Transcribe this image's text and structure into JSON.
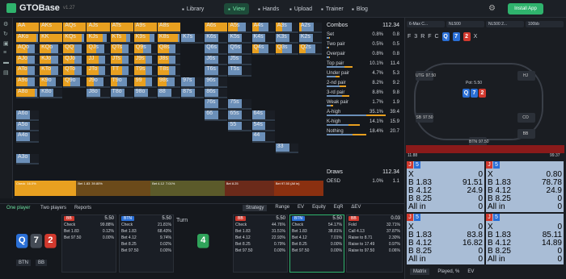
{
  "app": {
    "name": "GTOBase",
    "version": "v1.27"
  },
  "nav": [
    {
      "label": "Library",
      "icon": "library-icon"
    },
    {
      "label": "View",
      "icon": "grid-icon",
      "active": true
    },
    {
      "label": "Hands",
      "icon": "hands-icon"
    },
    {
      "label": "Upload",
      "icon": "upload-icon"
    },
    {
      "label": "Trainer",
      "icon": "trainer-icon"
    },
    {
      "label": "Blog",
      "icon": "blog-icon"
    }
  ],
  "install_label": "Install App",
  "grid": [
    [
      {
        "h": "AA",
        "f": 1.0
      },
      {
        "h": "AKs",
        "f": 1.0
      },
      {
        "h": "AQs",
        "f": 1.0
      },
      {
        "h": "AJs",
        "f": 1.0
      },
      {
        "h": "ATs",
        "f": 1.0
      },
      {
        "h": "A9s",
        "f": 1.0
      },
      {
        "h": "A8s",
        "f": 1.0
      },
      {
        "h": "",
        "f": 0
      },
      {
        "h": "A6s",
        "f": 1.0
      },
      {
        "h": "A5s",
        "f": 0.4
      },
      {
        "h": "A4s",
        "f": 0.3
      },
      {
        "h": "A3s",
        "f": 0.3
      },
      {
        "h": "A2s",
        "f": 0.1
      }
    ],
    [
      {
        "h": "AKo",
        "f": 0.9
      },
      {
        "h": "KK",
        "f": 1.0
      },
      {
        "h": "KQs",
        "f": 0.8
      },
      {
        "h": "KJs",
        "f": 0.7
      },
      {
        "h": "KTs",
        "f": 0.7
      },
      {
        "h": "K9s",
        "f": 0.7
      },
      {
        "h": "K8s",
        "f": 0.9
      },
      {
        "h": "K7s",
        "f": 0
      },
      {
        "h": "K6s",
        "f": 0
      },
      {
        "h": "K5s",
        "f": 0
      },
      {
        "h": "K4s",
        "f": 0
      },
      {
        "h": "K3s",
        "f": 0
      },
      {
        "h": "K2s",
        "f": 0
      }
    ],
    [
      {
        "h": "AQo",
        "f": 0.5
      },
      {
        "h": "KQo",
        "f": 0.5
      },
      {
        "h": "QQ",
        "f": 0.5
      },
      {
        "h": "QJs",
        "f": 0.4
      },
      {
        "h": "QTs",
        "f": 0.5
      },
      {
        "h": "Q9s",
        "f": 0.4
      },
      {
        "h": "Q8s",
        "f": 0.5
      },
      {
        "h": "",
        "f": 0
      },
      {
        "h": "Q6s",
        "f": 0
      },
      {
        "h": "Q5s",
        "f": 0
      },
      {
        "h": "Q4s",
        "f": 0.3
      },
      {
        "h": "Q3s",
        "f": 0.3
      },
      {
        "h": "Q2s",
        "f": 0.3
      }
    ],
    [
      {
        "h": "AJo",
        "f": 0.5
      },
      {
        "h": "KJo",
        "f": 0.5
      },
      {
        "h": "QJo",
        "f": 0.5
      },
      {
        "h": "JJ",
        "f": 0.5
      },
      {
        "h": "JTs",
        "f": 0.5
      },
      {
        "h": "J9s",
        "f": 0.5
      },
      {
        "h": "J8s",
        "f": 0.5
      },
      {
        "h": "",
        "f": 0
      },
      {
        "h": "J6s",
        "f": 0
      },
      {
        "h": "J5s",
        "f": 0
      },
      {
        "h": "",
        "f": 0
      },
      {
        "h": "",
        "f": 0
      },
      {
        "h": "",
        "f": 0
      }
    ],
    [
      {
        "h": "ATo",
        "f": 0.5
      },
      {
        "h": "KTo",
        "f": 0.5
      },
      {
        "h": "QTo",
        "f": 0.5
      },
      {
        "h": "JTo",
        "f": 0.5
      },
      {
        "h": "TT",
        "f": 0.5
      },
      {
        "h": "T9s",
        "f": 0.5
      },
      {
        "h": "T8s",
        "f": 0.5
      },
      {
        "h": "",
        "f": 0
      },
      {
        "h": "T6s",
        "f": 0
      },
      {
        "h": "T5s",
        "f": 0
      },
      {
        "h": "",
        "f": 0
      },
      {
        "h": "",
        "f": 0
      },
      {
        "h": "",
        "f": 0
      }
    ],
    [
      {
        "h": "A9o",
        "f": 0.5
      },
      {
        "h": "K9o",
        "f": 0.3
      },
      {
        "h": "Q9o",
        "f": 0.3
      },
      {
        "h": "J9o",
        "f": 0.3
      },
      {
        "h": "T9o",
        "f": 0.3
      },
      {
        "h": "99",
        "f": 0.5
      },
      {
        "h": "98s",
        "f": 0.4
      },
      {
        "h": "97s",
        "f": 0
      },
      {
        "h": "96s",
        "f": 0
      },
      {
        "h": "",
        "f": 0
      },
      {
        "h": "",
        "f": 0
      },
      {
        "h": "",
        "f": 0
      },
      {
        "h": "",
        "f": 0
      }
    ],
    [
      {
        "h": "A8o",
        "f": 0.8
      },
      {
        "h": "K8o",
        "f": 0
      },
      {
        "h": "",
        "f": 0
      },
      {
        "h": "J8o",
        "f": 0
      },
      {
        "h": "T8o",
        "f": 0
      },
      {
        "h": "98o",
        "f": 0
      },
      {
        "h": "88",
        "f": 0
      },
      {
        "h": "87s",
        "f": 0
      },
      {
        "h": "86s",
        "f": 0
      },
      {
        "h": "",
        "f": 0
      },
      {
        "h": "",
        "f": 0
      },
      {
        "h": "",
        "f": 0
      },
      {
        "h": "",
        "f": 0
      }
    ],
    [
      {
        "h": "",
        "f": 0
      },
      {
        "h": "",
        "f": 0
      },
      {
        "h": "",
        "f": 0
      },
      {
        "h": "",
        "f": 0
      },
      {
        "h": "",
        "f": 0
      },
      {
        "h": "",
        "f": 0
      },
      {
        "h": "",
        "f": 0
      },
      {
        "h": "",
        "f": 0
      },
      {
        "h": "76s",
        "f": 0
      },
      {
        "h": "75s",
        "f": 0
      },
      {
        "h": "",
        "f": 0
      },
      {
        "h": "",
        "f": 0
      },
      {
        "h": "",
        "f": 0
      }
    ],
    [
      {
        "h": "A6o",
        "f": 0
      },
      {
        "h": "",
        "f": 0
      },
      {
        "h": "",
        "f": 0
      },
      {
        "h": "",
        "f": 0
      },
      {
        "h": "",
        "f": 0
      },
      {
        "h": "",
        "f": 0
      },
      {
        "h": "",
        "f": 0
      },
      {
        "h": "",
        "f": 0
      },
      {
        "h": "66",
        "f": 0
      },
      {
        "h": "65s",
        "f": 0
      },
      {
        "h": "64s",
        "f": 0
      },
      {
        "h": "",
        "f": 0
      },
      {
        "h": "",
        "f": 0
      }
    ],
    [
      {
        "h": "A5o",
        "f": 0
      },
      {
        "h": "",
        "f": 0
      },
      {
        "h": "",
        "f": 0
      },
      {
        "h": "",
        "f": 0
      },
      {
        "h": "",
        "f": 0
      },
      {
        "h": "",
        "f": 0
      },
      {
        "h": "",
        "f": 0
      },
      {
        "h": "",
        "f": 0
      },
      {
        "h": "",
        "f": 0
      },
      {
        "h": "55",
        "f": 0
      },
      {
        "h": "54s",
        "f": 0
      },
      {
        "h": "",
        "f": 0
      },
      {
        "h": "",
        "f": 0
      }
    ],
    [
      {
        "h": "A4o",
        "f": 0
      },
      {
        "h": "",
        "f": 0
      },
      {
        "h": "",
        "f": 0
      },
      {
        "h": "",
        "f": 0
      },
      {
        "h": "",
        "f": 0
      },
      {
        "h": "",
        "f": 0
      },
      {
        "h": "",
        "f": 0
      },
      {
        "h": "",
        "f": 0
      },
      {
        "h": "",
        "f": 0
      },
      {
        "h": "",
        "f": 0
      },
      {
        "h": "44",
        "f": 0
      },
      {
        "h": "",
        "f": 0
      },
      {
        "h": "",
        "f": 0
      }
    ],
    [
      {
        "h": "",
        "f": 0
      },
      {
        "h": "",
        "f": 0
      },
      {
        "h": "",
        "f": 0
      },
      {
        "h": "",
        "f": 0
      },
      {
        "h": "",
        "f": 0
      },
      {
        "h": "",
        "f": 0
      },
      {
        "h": "",
        "f": 0
      },
      {
        "h": "",
        "f": 0
      },
      {
        "h": "",
        "f": 0
      },
      {
        "h": "",
        "f": 0
      },
      {
        "h": "",
        "f": 0
      },
      {
        "h": "33",
        "f": 0
      },
      {
        "h": "",
        "f": 0
      }
    ],
    [
      {
        "h": "A3o",
        "f": 0
      },
      {
        "h": "",
        "f": 0
      },
      {
        "h": "",
        "f": 0
      },
      {
        "h": "",
        "f": 0
      },
      {
        "h": "",
        "f": 0
      },
      {
        "h": "",
        "f": 0
      },
      {
        "h": "",
        "f": 0
      },
      {
        "h": "",
        "f": 0
      },
      {
        "h": "",
        "f": 0
      },
      {
        "h": "",
        "f": 0
      },
      {
        "h": "",
        "f": 0
      },
      {
        "h": "",
        "f": 0
      },
      {
        "h": "",
        "f": 0
      }
    ]
  ],
  "strategy_bar": [
    {
      "label": "Check",
      "pct": "16.0%",
      "color": "#e8a020",
      "w": 0.2
    },
    {
      "label": "Bet 1.83",
      "pct": "39.80%",
      "color": "#6b4a1a",
      "w": 0.24
    },
    {
      "label": "Bet 4.12",
      "pct": "7.01%",
      "color": "#5b5a2a",
      "w": 0.24
    },
    {
      "label": "Bet 8.25",
      "pct": "",
      "color": "#6b2a1a",
      "w": 0.16
    },
    {
      "label": "Bet 97.50 (All in)",
      "pct": "",
      "color": "#8a3010",
      "w": 0.16
    }
  ],
  "combos": {
    "title": "Combos",
    "total": "112.34",
    "rows": [
      {
        "n": "Set",
        "p": "0.8%",
        "c": "0.8",
        "w": 0.05
      },
      {
        "n": "Two pair",
        "p": "0.5%",
        "c": "0.5",
        "w": 0.04
      },
      {
        "n": "Overpair",
        "p": "0.8%",
        "c": "0.8",
        "w": 0.05
      },
      {
        "n": "Top pair",
        "p": "10.1%",
        "c": "11.4",
        "w": 0.4
      },
      {
        "n": "Under pair",
        "p": "4.7%",
        "c": "5.3",
        "w": 0.2
      },
      {
        "n": "2-nd pair",
        "p": "8.2%",
        "c": "9.2",
        "w": 0.3
      },
      {
        "n": "3-rd pair",
        "p": "8.8%",
        "c": "9.8",
        "w": 0.35
      },
      {
        "n": "Weak pair",
        "p": "1.7%",
        "c": "1.9",
        "w": 0.1
      },
      {
        "n": "A-high",
        "p": "35.1%",
        "c": "39.4",
        "w": 0.9
      },
      {
        "n": "K-high",
        "p": "14.1%",
        "c": "15.9",
        "w": 0.5
      },
      {
        "n": "Nothing",
        "p": "18.4%",
        "c": "20.7",
        "w": 0.6
      }
    ]
  },
  "draws": {
    "title": "Draws",
    "total": "112.34",
    "rows": [
      {
        "n": "OESD",
        "p": "1.0%",
        "c": "1.1"
      }
    ]
  },
  "right": {
    "top_selects": [
      "6-Max C...",
      "NL500",
      "NL500 2...",
      "100bb"
    ],
    "actions": [
      "F",
      "3",
      "R",
      "F",
      "C"
    ],
    "board_cards": [
      {
        "r": "Q",
        "c": "b"
      },
      {
        "r": "7",
        "c": "b"
      },
      {
        "r": "2",
        "c": "r"
      }
    ],
    "turn_label": "X",
    "pot": "Pot: 5.50",
    "seats": [
      {
        "n": "UTG",
        "s": "97.50"
      },
      {
        "n": "HJ",
        "s": ""
      },
      {
        "n": "CO",
        "s": ""
      },
      {
        "n": "SB",
        "s": "97.50"
      },
      {
        "n": "BTN",
        "s": "97.50"
      },
      {
        "n": "BB",
        "s": ""
      }
    ],
    "hist_low": "11.88",
    "hist_high": "99.37",
    "matrix": [
      {
        "cards": [
          "J",
          "5"
        ],
        "rows": [
          [
            "X",
            "0"
          ],
          [
            "B 1.83",
            "91.51"
          ],
          [
            "B 4.12",
            "24.9"
          ],
          [
            "B 8.25",
            "0"
          ],
          [
            "All in",
            "0"
          ]
        ]
      },
      {
        "cards": [
          "J",
          "5"
        ],
        "rows": [
          [
            "X",
            "0.80"
          ],
          [
            "B 1.83",
            "78.78"
          ],
          [
            "B 4.12",
            "24.9"
          ],
          [
            "B 8.25",
            "0"
          ],
          [
            "All in",
            "0"
          ]
        ]
      },
      {
        "cards": [
          "J",
          "5"
        ],
        "rows": [
          [
            "X",
            "0"
          ],
          [
            "B 1.83",
            "83.8"
          ],
          [
            "B 4.12",
            "16.82"
          ],
          [
            "B 8.25",
            "0"
          ],
          [
            "All in",
            "0"
          ]
        ]
      },
      {
        "cards": [
          "J",
          "5"
        ],
        "rows": [
          [
            "X",
            "0"
          ],
          [
            "B 1.83",
            "85.11"
          ],
          [
            "B 4.12",
            "14.89"
          ],
          [
            "B 8.25",
            "0"
          ],
          [
            "All in",
            "0"
          ]
        ]
      }
    ],
    "tabs": [
      "Matrix",
      "Played, %",
      "EV"
    ]
  },
  "bottom": {
    "tabs": [
      "One player",
      "Two players",
      "Reports"
    ],
    "right_tabs": [
      "Strategy",
      "Range",
      "EV",
      "Equity",
      "EqR",
      "ΔEV"
    ],
    "hand_cards": [
      {
        "r": "Q",
        "c": "b"
      },
      {
        "r": "7",
        "c": "k"
      },
      {
        "r": "2",
        "c": "r"
      }
    ],
    "positions": [
      "BTN",
      "BB"
    ],
    "turn": "Turn",
    "turn_card": {
      "r": "4",
      "c": "g"
    },
    "panels": [
      {
        "pos": "BB",
        "amt": "5.50",
        "rows": [
          [
            "Check",
            "99.88%"
          ],
          [
            "Bet 1.83",
            "0.12%"
          ],
          [
            "Bet 97.50",
            "0.00%"
          ]
        ]
      },
      {
        "pos": "BTN",
        "amt": "5.50",
        "rows": [
          [
            "Check",
            "21.81%"
          ],
          [
            "Bet 1.83",
            "68.43%"
          ],
          [
            "Bet 4.12",
            "9.74%"
          ],
          [
            "Bet 8.25",
            "0.02%"
          ],
          [
            "Bet 97.50",
            "0.00%"
          ]
        ]
      },
      {
        "pos": "BB",
        "amt": "5.50",
        "rows": [
          [
            "Check",
            "44.76%"
          ],
          [
            "Bet 1.83",
            "31.51%"
          ],
          [
            "Bet 4.12",
            "22.93%"
          ],
          [
            "Bet 8.25",
            "0.79%"
          ],
          [
            "Bet 97.50",
            "0.00%"
          ]
        ]
      },
      {
        "pos": "BTN",
        "amt": "5.50",
        "rows": [
          [
            "Check",
            "54.17%"
          ],
          [
            "Bet 1.83",
            "38.81%"
          ],
          [
            "Bet 4.12",
            "7.01%"
          ],
          [
            "Bet 8.25",
            "0.00%"
          ],
          [
            "Bet 97.50",
            "0.00%"
          ]
        ]
      },
      {
        "pos": "BB",
        "amt": "0.03",
        "rows": [
          [
            "Fold",
            "32.71%"
          ],
          [
            "Call 4.13",
            "37.87%"
          ],
          [
            "Raise to 8.71",
            "2.30%"
          ],
          [
            "Raise to 17.49",
            "0.97%"
          ],
          [
            "Raise to 97.50",
            "0.06%"
          ]
        ]
      }
    ]
  }
}
